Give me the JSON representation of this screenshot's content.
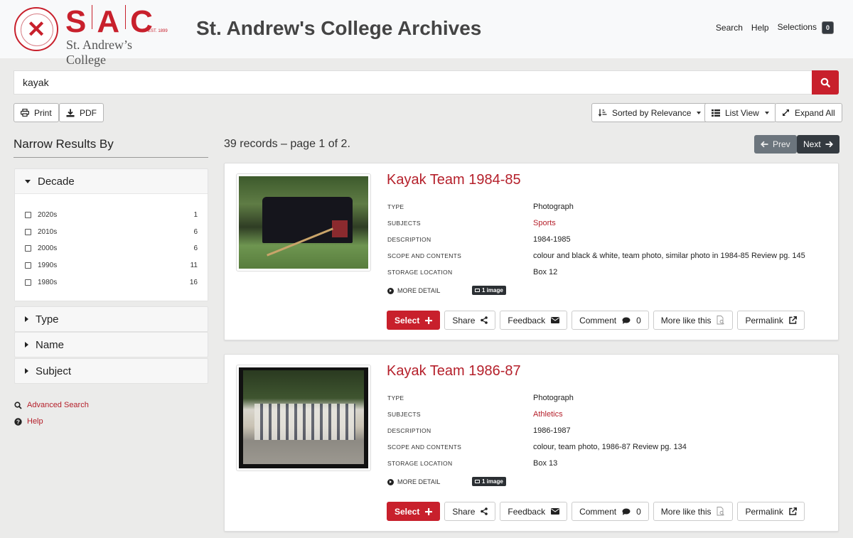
{
  "header": {
    "logo_letters": [
      "S",
      "A",
      "C"
    ],
    "logo_est": "EST. 1899",
    "logo_name": "St. Andrew’s College",
    "crest_icon": "college-crest",
    "site_title": "St. Andrew's College Archives",
    "nav": {
      "search": "Search",
      "help": "Help",
      "selections": "Selections",
      "selections_count": "0"
    }
  },
  "search": {
    "value": "kayak",
    "placeholder": "",
    "button_icon": "search-icon"
  },
  "toolbar": {
    "print": "Print",
    "pdf": "PDF",
    "sort": "Sorted by Relevance",
    "view": "List View",
    "expand": "Expand All"
  },
  "sidebar": {
    "title": "Narrow Results By",
    "facets": [
      {
        "label": "Decade",
        "expanded": true,
        "options": [
          {
            "label": "2020s",
            "count": "1"
          },
          {
            "label": "2010s",
            "count": "6"
          },
          {
            "label": "2000s",
            "count": "6"
          },
          {
            "label": "1990s",
            "count": "11"
          },
          {
            "label": "1980s",
            "count": "16"
          }
        ]
      },
      {
        "label": "Type",
        "expanded": false
      },
      {
        "label": "Name",
        "expanded": false
      },
      {
        "label": "Subject",
        "expanded": false
      }
    ],
    "links": {
      "advanced_search": "Advanced Search",
      "help": "Help"
    }
  },
  "results": {
    "summary": "39 records – page 1 of 2.",
    "prev": "Prev",
    "next": "Next",
    "labels": {
      "type": "Type",
      "subjects": "Subjects",
      "description": "Description",
      "scope": "Scope and Contents",
      "storage": "Storage Location",
      "more_detail": "MORE DETAIL"
    },
    "actions": {
      "select": "Select",
      "share": "Share",
      "feedback": "Feedback",
      "comment": "Comment",
      "more_like": "More like this",
      "permalink": "Permalink"
    },
    "items": [
      {
        "title": "Kayak Team 1984-85",
        "type": "Photograph",
        "subjects": "Sports",
        "description": "1984-1985",
        "scope": "colour and black & white, team photo, similar photo in 1984-85 Review pg. 145",
        "storage": "Box 12",
        "image_badge": "1 image",
        "comment_count": "0"
      },
      {
        "title": "Kayak Team 1986-87",
        "type": "Photograph",
        "subjects": "Athletics",
        "description": "1986-1987",
        "scope": "colour, team photo, 1986-87 Review pg. 134",
        "storage": "Box 13",
        "image_badge": "1 image",
        "comment_count": "0"
      }
    ]
  },
  "colors": {
    "brand_red": "#c8202c",
    "link_red": "#b5202b",
    "dark": "#343a40",
    "secondary": "#6c757d"
  }
}
